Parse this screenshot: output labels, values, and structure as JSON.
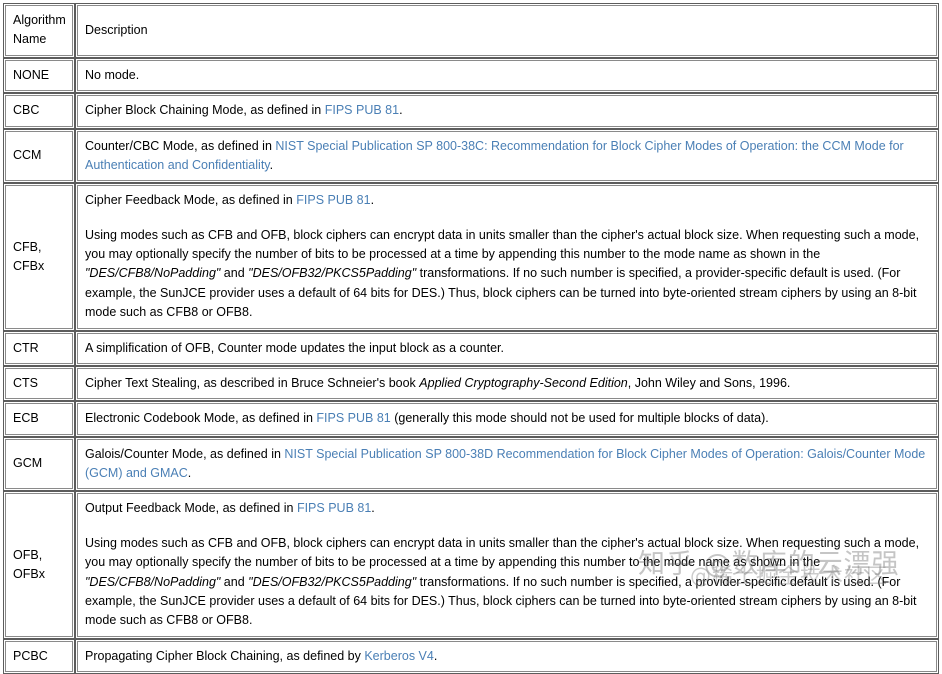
{
  "table": {
    "columns": [
      {
        "key": "algorithm_name",
        "label": "Algorithm\nName"
      },
      {
        "key": "description",
        "label": "Description"
      }
    ],
    "rows": [
      {
        "algorithm_name": "NONE",
        "paragraphs": [
          [
            {
              "t": "No mode.",
              "s": "plain"
            }
          ]
        ]
      },
      {
        "algorithm_name": "CBC",
        "paragraphs": [
          [
            {
              "t": "Cipher Block Chaining Mode, as defined in ",
              "s": "plain"
            },
            {
              "t": "FIPS PUB 81",
              "s": "link"
            },
            {
              "t": ".",
              "s": "plain"
            }
          ]
        ]
      },
      {
        "algorithm_name": "CCM",
        "paragraphs": [
          [
            {
              "t": "Counter/CBC Mode, as defined in ",
              "s": "plain"
            },
            {
              "t": "NIST Special Publication SP 800-38C: Recommendation for Block Cipher Modes of Operation: the CCM Mode for Authentication and Confidentiality",
              "s": "link"
            },
            {
              "t": ".",
              "s": "plain"
            }
          ]
        ]
      },
      {
        "algorithm_name": "CFB,\nCFBx",
        "paragraphs": [
          [
            {
              "t": "Cipher Feedback Mode, as defined in ",
              "s": "plain"
            },
            {
              "t": "FIPS PUB 81",
              "s": "link"
            },
            {
              "t": ".",
              "s": "plain"
            }
          ],
          [
            {
              "t": "Using modes such as CFB and OFB, block ciphers can encrypt data in units smaller than the cipher's actual block size. When requesting such a mode, you may optionally specify the number of bits to be processed at a time by appending this number to the mode name as shown in the ",
              "s": "plain"
            },
            {
              "t": "\"DES/CFB8/NoPadding\"",
              "s": "italic"
            },
            {
              "t": " and ",
              "s": "plain"
            },
            {
              "t": "\"DES/OFB32/PKCS5Padding\"",
              "s": "italic"
            },
            {
              "t": " transformations. If no such number is specified, a provider-specific default is used. (For example, the SunJCE provider uses a default of 64 bits for DES.) Thus, block ciphers can be turned into byte-oriented stream ciphers by using an 8-bit mode such as CFB8 or OFB8.",
              "s": "plain"
            }
          ]
        ]
      },
      {
        "algorithm_name": "CTR",
        "paragraphs": [
          [
            {
              "t": "A simplification of OFB, Counter mode updates the input block as a counter.",
              "s": "plain"
            }
          ]
        ]
      },
      {
        "algorithm_name": "CTS",
        "paragraphs": [
          [
            {
              "t": "Cipher Text Stealing, as described in Bruce Schneier's book ",
              "s": "plain"
            },
            {
              "t": "Applied Cryptography-Second Edition",
              "s": "italic"
            },
            {
              "t": ", John Wiley and Sons, 1996.",
              "s": "plain"
            }
          ]
        ]
      },
      {
        "algorithm_name": "ECB",
        "paragraphs": [
          [
            {
              "t": "Electronic Codebook Mode, as defined in ",
              "s": "plain"
            },
            {
              "t": "FIPS PUB 81",
              "s": "link"
            },
            {
              "t": " (generally this mode should not be used for multiple blocks of data).",
              "s": "plain"
            }
          ]
        ]
      },
      {
        "algorithm_name": "GCM",
        "paragraphs": [
          [
            {
              "t": "Galois/Counter Mode, as defined in ",
              "s": "plain"
            },
            {
              "t": "NIST Special Publication SP 800-38D Recommendation for Block Cipher Modes of Operation: Galois/Counter Mode (GCM) and GMAC",
              "s": "link"
            },
            {
              "t": ".",
              "s": "plain"
            }
          ]
        ]
      },
      {
        "algorithm_name": "OFB,\nOFBx",
        "paragraphs": [
          [
            {
              "t": "Output Feedback Mode, as defined in ",
              "s": "plain"
            },
            {
              "t": "FIPS PUB 81",
              "s": "link"
            },
            {
              "t": ".",
              "s": "plain"
            }
          ],
          [
            {
              "t": "Using modes such as CFB and OFB, block ciphers can encrypt data in units smaller than the cipher's actual block size. When requesting such a mode, you may optionally specify the number of bits to be processed at a time by appending this number to the mode name as shown in the ",
              "s": "plain"
            },
            {
              "t": "\"DES/CFB8/NoPadding\"",
              "s": "italic"
            },
            {
              "t": " and ",
              "s": "plain"
            },
            {
              "t": "\"DES/OFB32/PKCS5Padding\"",
              "s": "italic"
            },
            {
              "t": " transformations. If no such number is specified, a provider-specific default is used. (For example, the SunJCE provider uses a default of 64 bits for DES.) Thus, block ciphers can be turned into byte-oriented stream ciphers by using an 8-bit mode such as CFB8 or OFB8.",
              "s": "plain"
            }
          ]
        ]
      },
      {
        "algorithm_name": "PCBC",
        "paragraphs": [
          [
            {
              "t": "Propagating Cipher Block Chaining, as defined by ",
              "s": "plain"
            },
            {
              "t": "Kerberos V4",
              "s": "link"
            },
            {
              "t": ".",
              "s": "plain"
            }
          ]
        ]
      }
    ]
  },
  "watermarks": {
    "primary": "知乎 @数库的云漂强",
    "secondary": "@稀土掘金技术社区"
  },
  "colors": {
    "link": "#4a7fb5",
    "border": "#5c5c5c",
    "text": "#000000",
    "background": "#ffffff",
    "watermark": "#6e6e6e"
  }
}
